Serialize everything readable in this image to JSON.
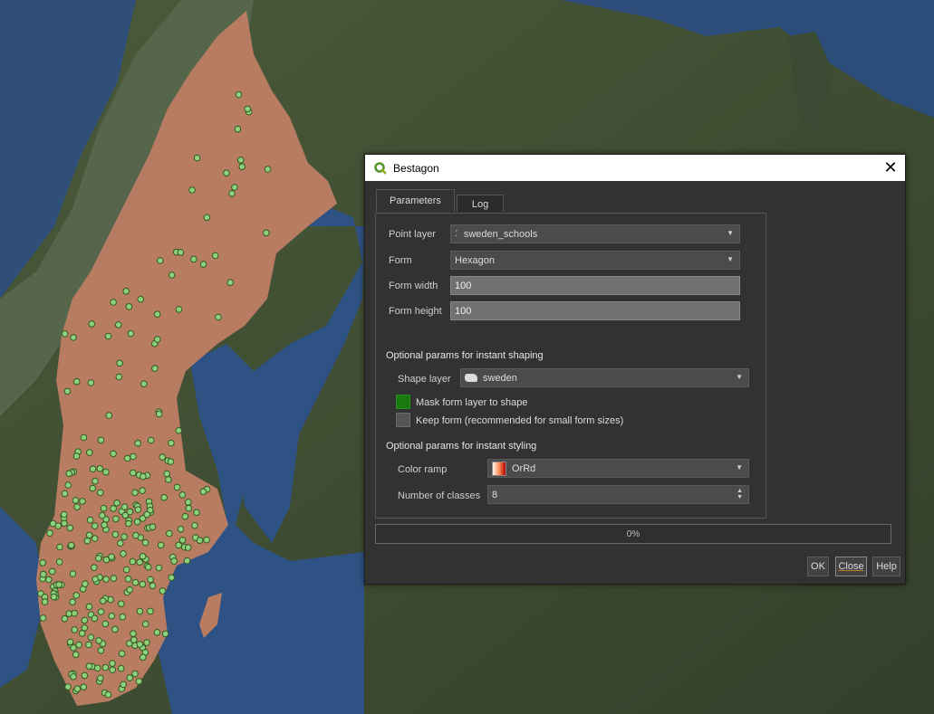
{
  "dialog": {
    "title": "Bestagon",
    "close_glyph": "✕",
    "tabs": [
      {
        "label": "Parameters",
        "active": true
      },
      {
        "label": "Log",
        "active": false
      }
    ],
    "point_layer": {
      "label": "Point layer",
      "value": "sweden_schools",
      "icon": "point-layer-icon"
    },
    "form": {
      "label": "Form",
      "value": "Hexagon"
    },
    "form_width": {
      "label": "Form width",
      "value": "100"
    },
    "form_height": {
      "label": "Form height",
      "value": "100"
    },
    "shaping_section": "Optional params for instant shaping",
    "shape_layer": {
      "label": "Shape layer",
      "value": "sweden",
      "icon": "polygon-layer-icon"
    },
    "mask_checkbox": {
      "label": "Mask form layer to shape",
      "checked": true,
      "color": "#1a7a12"
    },
    "keep_checkbox": {
      "label": "Keep form (recommended for small form sizes)",
      "checked": false
    },
    "styling_section": "Optional params for instant styling",
    "color_ramp": {
      "label": "Color ramp",
      "value": "OrRd",
      "icon": "color-ramp-icon"
    },
    "num_classes": {
      "label": "Number of classes",
      "value": "8"
    },
    "progress": {
      "text": "0%",
      "value": 0
    },
    "buttons": {
      "ok": "OK",
      "close": "Close",
      "help": "Help"
    }
  },
  "map": {
    "colors": {
      "land": "#3e4a30",
      "water": "#2f4f7a",
      "country": "#b77c62",
      "points": "#8ed07c"
    }
  }
}
